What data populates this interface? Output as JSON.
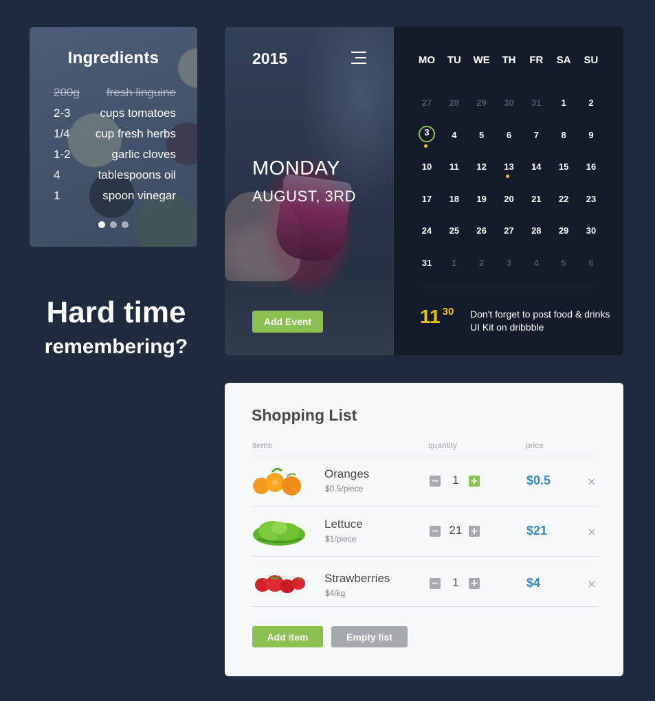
{
  "ingredients": {
    "title": "Ingredients",
    "items": [
      {
        "qty": "200g",
        "name": "fresh linguine",
        "done": true
      },
      {
        "qty": "2-3",
        "name": "cups tomatoes",
        "done": false
      },
      {
        "qty": "1/4",
        "name": "cup fresh herbs",
        "done": false
      },
      {
        "qty": "1-2",
        "name": "garlic cloves",
        "done": false
      },
      {
        "qty": "4",
        "name": "tablespoons oil",
        "done": false
      },
      {
        "qty": "1",
        "name": "spoon vinegar",
        "done": false
      }
    ],
    "pages": 3,
    "active_page": 1
  },
  "hero": {
    "title": "Hard time",
    "subtitle": "remembering?"
  },
  "calendar": {
    "year": "2015",
    "day_name": "MONDAY",
    "date_label": "AUGUST, 3RD",
    "add_event_label": "Add Event",
    "weekdays": [
      "MO",
      "TU",
      "WE",
      "TH",
      "FR",
      "SA",
      "SU"
    ],
    "weeks": [
      [
        {
          "d": "27",
          "m": true
        },
        {
          "d": "28",
          "m": true
        },
        {
          "d": "29",
          "m": true
        },
        {
          "d": "30",
          "m": true
        },
        {
          "d": "31",
          "m": true
        },
        {
          "d": "1"
        },
        {
          "d": "2"
        }
      ],
      [
        {
          "d": "3",
          "today": true,
          "event": true
        },
        {
          "d": "4"
        },
        {
          "d": "5"
        },
        {
          "d": "6"
        },
        {
          "d": "7"
        },
        {
          "d": "8"
        },
        {
          "d": "9"
        }
      ],
      [
        {
          "d": "10"
        },
        {
          "d": "11"
        },
        {
          "d": "12"
        },
        {
          "d": "13",
          "event": true
        },
        {
          "d": "14"
        },
        {
          "d": "15"
        },
        {
          "d": "16"
        }
      ],
      [
        {
          "d": "17"
        },
        {
          "d": "18"
        },
        {
          "d": "19"
        },
        {
          "d": "20"
        },
        {
          "d": "21"
        },
        {
          "d": "22"
        },
        {
          "d": "23"
        }
      ],
      [
        {
          "d": "24"
        },
        {
          "d": "25"
        },
        {
          "d": "26"
        },
        {
          "d": "27"
        },
        {
          "d": "28"
        },
        {
          "d": "29"
        },
        {
          "d": "30"
        }
      ],
      [
        {
          "d": "31"
        },
        {
          "d": "1",
          "m": true
        },
        {
          "d": "2",
          "m": true
        },
        {
          "d": "3",
          "m": true
        },
        {
          "d": "4",
          "m": true
        },
        {
          "d": "5",
          "m": true
        },
        {
          "d": "6",
          "m": true
        }
      ]
    ],
    "reminder": {
      "hour": "11",
      "minute": "30",
      "text": "Don't forget to post food & drinks UI Kit on dribbble"
    },
    "colors": {
      "today_ring": "#8bc151",
      "event_dot": "#f4c20d"
    }
  },
  "shopping": {
    "title": "Shopping List",
    "columns": {
      "items": "items",
      "quantity": "quantity",
      "price": "price"
    },
    "items": [
      {
        "name": "Oranges",
        "unit": "$0.5/piece",
        "qty": "1",
        "price": "$0.5",
        "image": "oranges-image"
      },
      {
        "name": "Lettuce",
        "unit": "$1/piece",
        "qty": "21",
        "price": "$21",
        "image": "lettuce-image"
      },
      {
        "name": "Strawberries",
        "unit": "$4/kg",
        "qty": "1",
        "price": "$4",
        "image": "strawberries-image"
      }
    ],
    "minus_symbol": "−",
    "plus_symbol": "+",
    "remove_symbol": "×",
    "add_item_label": "Add item",
    "empty_list_label": "Empty list",
    "colors": {
      "accent_green": "#8bc151",
      "price_blue": "#3b8bc4",
      "neutral_gray": "#a6a9ad"
    }
  }
}
